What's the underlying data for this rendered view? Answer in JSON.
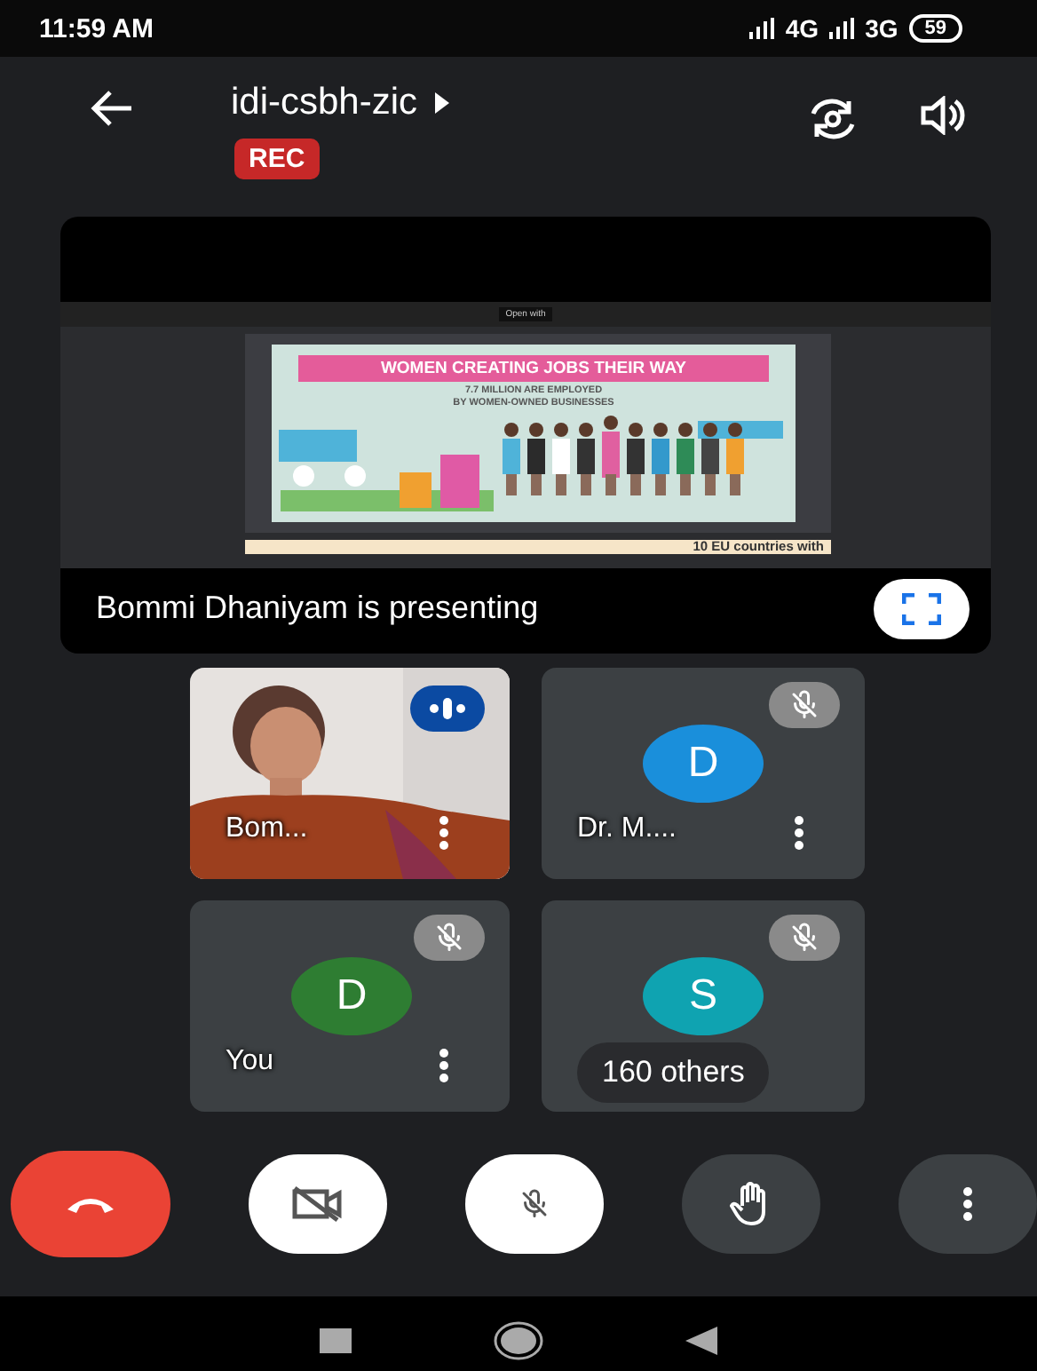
{
  "status_bar": {
    "time": "11:59 AM",
    "network_1": "4G",
    "network_2": "3G",
    "battery": "59"
  },
  "header": {
    "meeting_code": "idi-csbh-zic",
    "recording_badge": "REC"
  },
  "presentation": {
    "viewer_button": "Open with",
    "slide_title": "WOMEN CREATING JOBS THEIR WAY",
    "slide_line_1": "7.7 MILLION ARE EMPLOYED",
    "slide_line_2": "BY WOMEN-OWNED BUSINESSES",
    "next_slide_text": "10 EU countries with",
    "caption": "Bommi Dhaniyam is presenting"
  },
  "participants": [
    {
      "kind": "video",
      "name": "Bom...",
      "muted": false,
      "speaking": true
    },
    {
      "kind": "avatar",
      "initial": "D",
      "name": "Dr. M....",
      "color": "#1a8fdb",
      "muted": true,
      "speaking": false
    },
    {
      "kind": "avatar",
      "initial": "D",
      "name": "You",
      "color": "#2e7d32",
      "muted": true,
      "speaking": false
    },
    {
      "kind": "avatar",
      "initial": "S",
      "color": "#0fa3b1",
      "muted": true,
      "speaking": false,
      "others_pill": "160 others"
    }
  ],
  "controls": {
    "camera_on": false,
    "mic_on": false
  }
}
